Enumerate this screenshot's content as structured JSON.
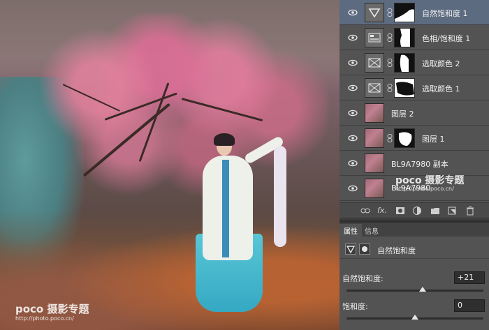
{
  "layers": [
    {
      "name": "自然饱和度 1",
      "type": "adjustment",
      "icon": "vibrance-icon",
      "visible": true,
      "selected": true,
      "has_mask": true
    },
    {
      "name": "色相/饱和度 1",
      "type": "adjustment",
      "icon": "hue-saturation-icon",
      "visible": true,
      "selected": false,
      "has_mask": true
    },
    {
      "name": "选取颜色 2",
      "type": "adjustment",
      "icon": "selective-color-icon",
      "visible": true,
      "selected": false,
      "has_mask": true
    },
    {
      "name": "选取颜色 1",
      "type": "adjustment",
      "icon": "selective-color-icon",
      "visible": true,
      "selected": false,
      "has_mask": true
    },
    {
      "name": "图层 2",
      "type": "pixel",
      "icon": "photo-thumbnail",
      "visible": true,
      "selected": false,
      "has_mask": false
    },
    {
      "name": "图层 1",
      "type": "pixel",
      "icon": "photo-thumbnail",
      "visible": true,
      "selected": false,
      "has_mask": true
    },
    {
      "name": "BL9A7980 副本",
      "type": "pixel",
      "icon": "photo-thumbnail",
      "visible": true,
      "selected": false,
      "has_mask": false
    },
    {
      "name": "BL9A7980",
      "type": "pixel",
      "icon": "photo-thumbnail",
      "visible": true,
      "selected": false,
      "has_mask": false
    }
  ],
  "layer_toolbar": [
    "link-layers-icon",
    "fx-icon",
    "add-mask-icon",
    "adjustment-layer-icon",
    "group-folder-icon",
    "new-layer-icon",
    "trash-icon"
  ],
  "layer_toolbar_fx": "fx.",
  "properties": {
    "tabs": [
      "属性",
      "信息"
    ],
    "active_tab": "属性",
    "adjustment_title": "自然饱和度",
    "vibrance_label": "自然饱和度:",
    "vibrance_value": "+21",
    "vibrance_level": 0.555,
    "saturation_label": "饱和度:",
    "saturation_value": "0",
    "saturation_level": 0.5
  },
  "watermark": {
    "brand": "poco 摄影专题",
    "url": "http://photo.poco.cn/"
  },
  "colors": {
    "panel_bg": "#535353",
    "selected_layer_bg": "#5d6b80",
    "robe_trim": "#3a8db8",
    "skirt": "#35a9c3"
  }
}
